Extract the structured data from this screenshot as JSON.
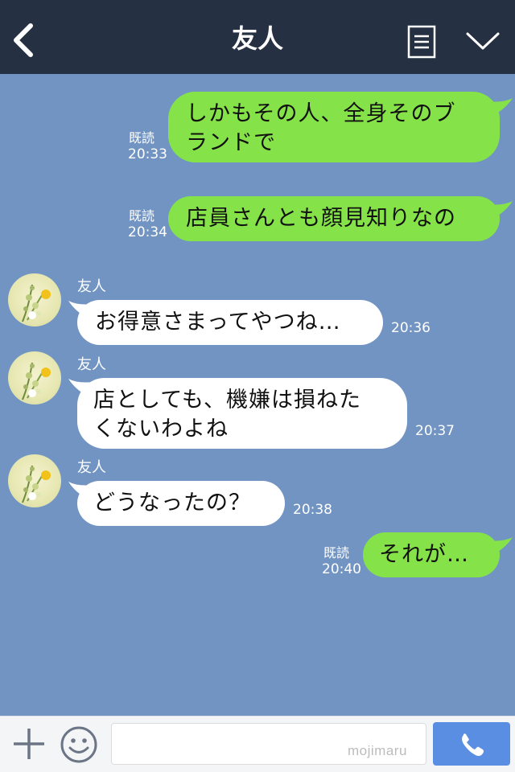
{
  "header": {
    "title": "友人",
    "back_icon": "chevron-left-icon",
    "menu_icon": "list-icon",
    "expand_icon": "chevron-down-icon"
  },
  "messages": [
    {
      "direction": "outgoing",
      "lines": [
        "しかもその人、全身そのブ",
        "ランドで"
      ],
      "read": "既読",
      "time": "20:33"
    },
    {
      "direction": "outgoing",
      "lines": [
        "店員さんとも顔見知りなの"
      ],
      "read": "既読",
      "time": "20:34"
    },
    {
      "direction": "incoming",
      "sender": "友人",
      "lines": [
        "お得意さまってやつね…"
      ],
      "time": "20:36"
    },
    {
      "direction": "incoming",
      "sender": "友人",
      "lines": [
        "店としても、機嫌は損ねた",
        "くないわよね"
      ],
      "time": "20:37"
    },
    {
      "direction": "incoming",
      "sender": "友人",
      "lines": [
        "どうなったの？"
      ],
      "time": "20:38"
    },
    {
      "direction": "outgoing",
      "lines": [
        "それが…"
      ],
      "read": "既読",
      "time": "20:40"
    }
  ],
  "footer": {
    "add_icon": "plus-icon",
    "emoji_icon": "smiley-icon",
    "input_value": "",
    "watermark": "mojimaru",
    "call_icon": "phone-icon"
  },
  "colors": {
    "header_bg": "#263043",
    "chat_bg": "#7194c3",
    "outgoing_bubble": "#85e249",
    "incoming_bubble": "#ffffff",
    "call_button": "#5a8ee3"
  }
}
